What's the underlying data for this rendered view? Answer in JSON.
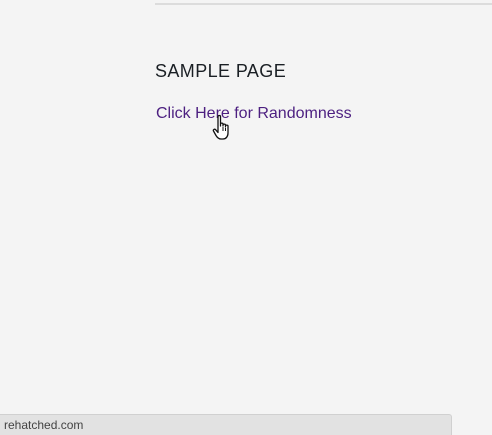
{
  "page": {
    "title": "SAMPLE PAGE",
    "link_label": "Click Here for Randomness"
  },
  "status_bar": {
    "url": "rehatched.com"
  },
  "cursor": {
    "icon": "hand-pointer-icon"
  },
  "colors": {
    "background": "#f4f4f4",
    "link": "#4c1f80",
    "heading": "#1a1f24"
  }
}
